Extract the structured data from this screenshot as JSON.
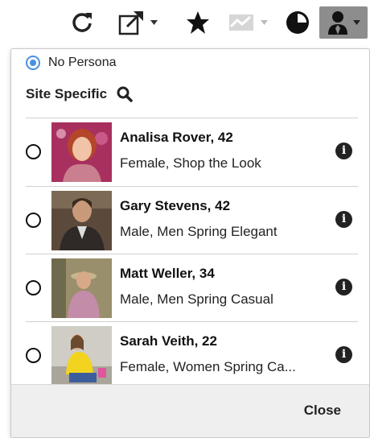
{
  "toolbar": {
    "icons": [
      "refresh-icon",
      "open-external-icon",
      "star-icon",
      "chart-icon",
      "history-icon",
      "persona-icon"
    ]
  },
  "panel": {
    "no_persona_label": "No Persona",
    "site_specific_label": "Site Specific",
    "personas": [
      {
        "name": "Analisa Rover, 42",
        "description": "Female, Shop the Look"
      },
      {
        "name": "Gary Stevens, 42",
        "description": "Male, Men Spring Elegant"
      },
      {
        "name": "Matt Weller, 34",
        "description": "Male, Men Spring Casual"
      },
      {
        "name": "Sarah Veith, 22",
        "description": "Female, Women Spring Ca..."
      }
    ],
    "info_glyph": "i",
    "close_label": "Close"
  },
  "colors": {
    "radio_selected": "#4a90e2",
    "persona_button_bg": "#8d8d8d",
    "footer_bg": "#efefef"
  }
}
